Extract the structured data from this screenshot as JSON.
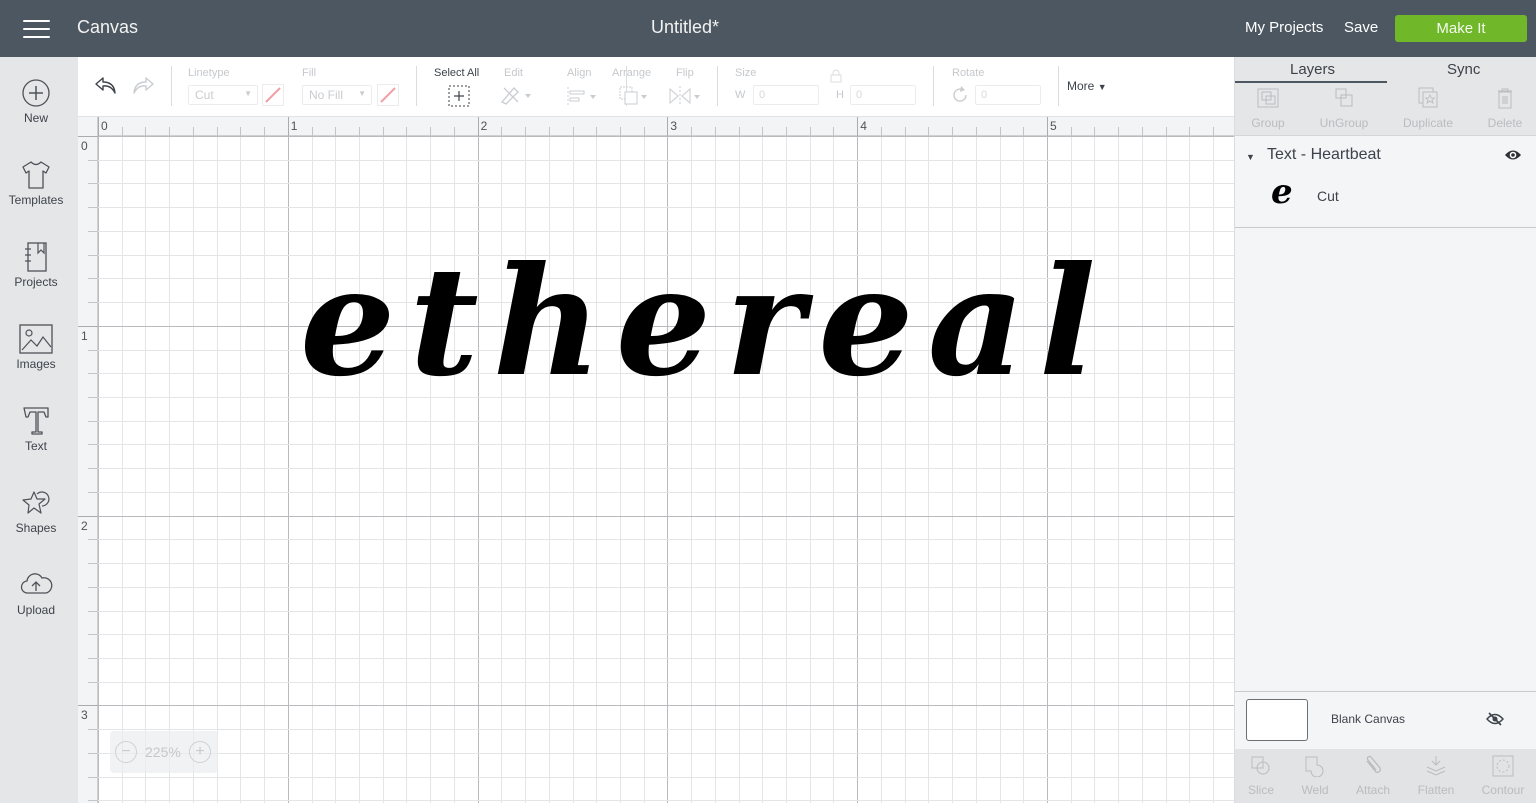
{
  "header": {
    "app_title": "Canvas",
    "doc_title": "Untitled*",
    "my_projects": "My Projects",
    "save": "Save",
    "make_it": "Make It",
    "colors": {
      "bar": "#4d5761",
      "make_it": "#70b82a"
    }
  },
  "sidebar": {
    "items": [
      {
        "label": "New",
        "icon": "plus-circle-icon"
      },
      {
        "label": "Templates",
        "icon": "tshirt-icon"
      },
      {
        "label": "Projects",
        "icon": "notebook-icon"
      },
      {
        "label": "Images",
        "icon": "image-icon"
      },
      {
        "label": "Text",
        "icon": "text-t-icon"
      },
      {
        "label": "Shapes",
        "icon": "shapes-icon"
      },
      {
        "label": "Upload",
        "icon": "cloud-upload-icon"
      }
    ]
  },
  "toolbar": {
    "linetype_label": "Linetype",
    "linetype_value": "Cut",
    "fill_label": "Fill",
    "fill_value": "No Fill",
    "select_all": "Select All",
    "edit": "Edit",
    "align": "Align",
    "arrange": "Arrange",
    "flip": "Flip",
    "size": "Size",
    "w_label": "W",
    "w_value": "0",
    "h_label": "H",
    "h_value": "0",
    "rotate": "Rotate",
    "rotate_value": "0",
    "more": "More"
  },
  "canvas": {
    "ruler_x": [
      "0",
      "1",
      "2",
      "3",
      "4",
      "5"
    ],
    "ruler_y": [
      "0",
      "1",
      "2",
      "3"
    ],
    "text": "ethereal",
    "zoom": "225%"
  },
  "right_panel": {
    "tabs": [
      "Layers",
      "Sync"
    ],
    "active_tab": "Layers",
    "layer_actions": [
      "Group",
      "UnGroup",
      "Duplicate",
      "Delete"
    ],
    "layer_group": {
      "title": "Text - Heartbeat",
      "items": [
        {
          "glyph": "e",
          "label": "Cut"
        }
      ]
    },
    "blank_canvas": "Blank Canvas",
    "bottom_actions": [
      "Slice",
      "Weld",
      "Attach",
      "Flatten",
      "Contour"
    ]
  }
}
